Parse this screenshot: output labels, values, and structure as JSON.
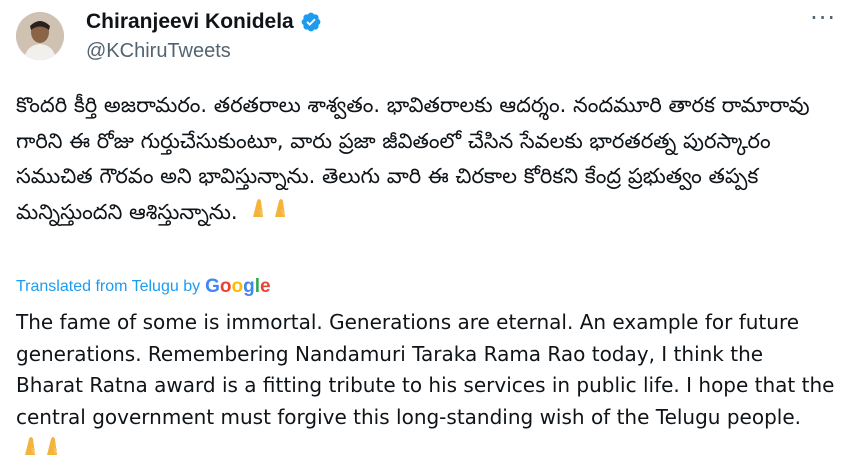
{
  "tweet": {
    "author": {
      "display_name": "Chiranjeevi Konidela",
      "handle": "@KChiruTweets",
      "verified_icon": "verified-badge-icon",
      "avatar_icon": "avatar"
    },
    "original_text": "కొందరి కీర్తి అజరామరం. తరతరాలు శాశ్వతం. భావితరాలకు ఆదర్శం. నందమూరి తారక రామారావు గారిని ఈ రోజు గుర్తుచేసుకుంటూ, వారు ప్రజా జీవితంలో చేసిన సేవలకు భారతరత్న పురస్కారం సముచిత గౌరవం అని భావిస్తున్నాను. తెలుగు వారి ఈ చిరకాల కోరికని కేంద్ర ప్రభుత్వం తప్పక మన్నిస్తుందని ఆశిస్తున్నాను.",
    "translation_label": "Translated from Telugu by",
    "translation_provider": "Google",
    "translated_text": "The fame of some is immortal. Generations are eternal. An example for future generations. Remembering Nandamuri Taraka Rama Rao today, I think the Bharat Ratna award is a fitting tribute to his services in public life. I hope that the central government must forgive this long-standing wish of the Telugu people.",
    "more_icon": "more-options-icon"
  },
  "colors": {
    "text": "#0f1419",
    "secondary": "#536471",
    "link": "#1d9bf0",
    "verified": "#1d9bf0"
  }
}
